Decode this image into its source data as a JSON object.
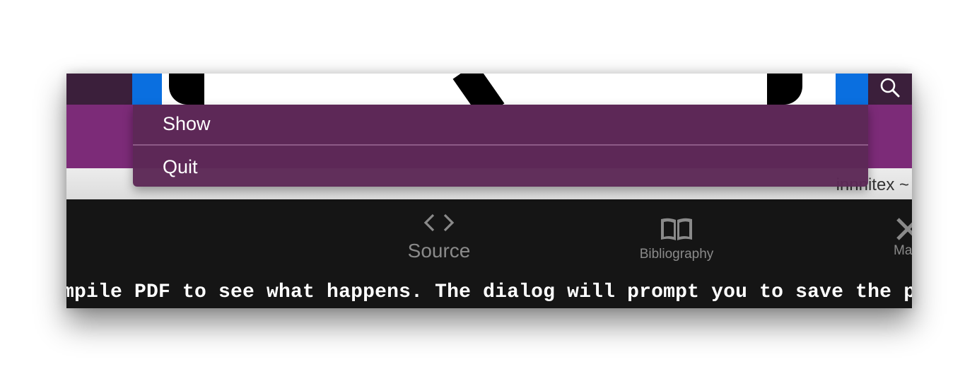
{
  "menubar": {
    "search_icon": "search-icon"
  },
  "toolbar": {
    "account_label": "innnitex ~"
  },
  "tabs": [
    {
      "label": "Source",
      "icon": "code-brackets-icon"
    },
    {
      "label": "Bibliography",
      "icon": "book-icon"
    },
    {
      "label": "Ma",
      "icon": "close-x-icon"
    }
  ],
  "editor": {
    "visible_text": "mpile PDF to see what happens. The dialog will prompt you to save the p"
  },
  "menu": {
    "items": [
      {
        "label": "Show"
      },
      {
        "label": "Quit"
      }
    ]
  },
  "colors": {
    "menubar": "#3b1f3b",
    "status_item_accent": "#0a6fe0",
    "app_header": "#7c2b78",
    "menu_background": "#5c2856",
    "dark_panel": "#151515"
  }
}
